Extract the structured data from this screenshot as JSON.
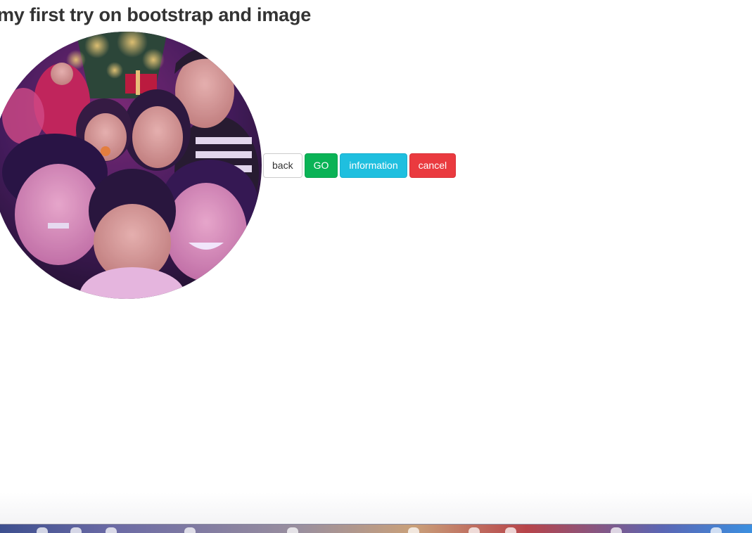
{
  "page": {
    "title": "my first try on bootstrap and image"
  },
  "image": {
    "description_icon": "family-photo-image"
  },
  "buttons": {
    "back": "back",
    "go": "GO",
    "information": "information",
    "cancel": "cancel"
  },
  "colors": {
    "title_text": "#333333",
    "btn_success": "#0ab356",
    "btn_info": "#1fbfdf",
    "btn_danger": "#ea3a3f",
    "btn_default_border": "#cccccc"
  }
}
